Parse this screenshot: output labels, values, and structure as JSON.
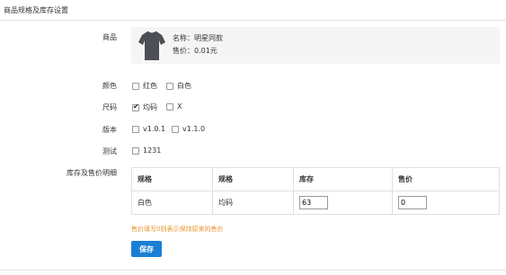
{
  "header": {
    "title": "商品规格及库存设置"
  },
  "product": {
    "label": "商品",
    "name": "名称：明星同款",
    "price": "售价：0.01元"
  },
  "specs": [
    {
      "label": "颜色",
      "options": [
        {
          "text": "红色",
          "checked": false
        },
        {
          "text": "白色",
          "checked": false
        }
      ]
    },
    {
      "label": "尺码",
      "options": [
        {
          "text": "均码",
          "checked": true
        },
        {
          "text": "X",
          "checked": false
        }
      ]
    },
    {
      "label": "版本",
      "options": [
        {
          "text": "v1.0.1",
          "checked": false
        },
        {
          "text": "v1.1.0",
          "checked": false
        }
      ]
    },
    {
      "label": "测试",
      "options": [
        {
          "text": "1231",
          "checked": false
        }
      ]
    }
  ],
  "detail": {
    "label": "库存及售价明细",
    "columns": [
      "规格",
      "规格",
      "库存",
      "售价"
    ],
    "rows": [
      {
        "spec1": "白色",
        "spec2": "均码",
        "stock": "63",
        "price": "0"
      }
    ]
  },
  "hint": "售价填写0则表示保持原来的售价",
  "save_label": "保存",
  "colors": {
    "accent": "#1a7fd4",
    "hint": "#e8962d"
  }
}
